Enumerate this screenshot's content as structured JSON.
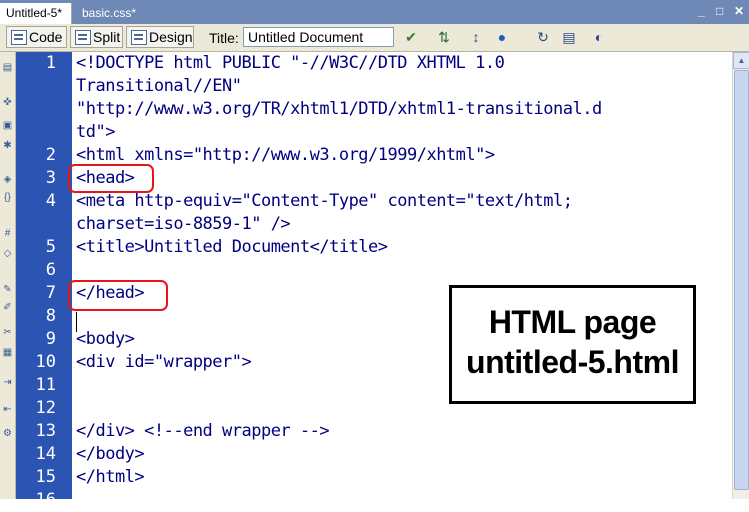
{
  "tabs": [
    {
      "label": "Untitled-5*",
      "active": true
    },
    {
      "label": "basic.css*",
      "active": false
    }
  ],
  "window_controls": {
    "minimize": "_",
    "restore": "□"
  },
  "toolbar": {
    "code_label": "Code",
    "split_label": "Split",
    "design_label": "Design",
    "title_label": "Title:",
    "title_value": "Untitled Document",
    "icons": [
      "validate-markup-icon",
      "file-management-icon",
      "preview-browser-icon",
      "refresh-icon",
      "view-options-icon",
      "visual-aids-icon"
    ]
  },
  "editor": {
    "line_numbers": [
      "1",
      "2",
      "3",
      "4",
      "5",
      "6",
      "7",
      "8",
      "9",
      "10",
      "11",
      "12",
      "13",
      "14",
      "15"
    ],
    "lines": [
      "<!DOCTYPE html PUBLIC \"-//W3C//DTD XHTML 1.0",
      "Transitional//EN\"",
      "\"http://www.w3.org/TR/xhtml1/DTD/xhtml1-transitional.d",
      "td\">",
      "<html xmlns=\"http://www.w3.org/1999/xhtml\">",
      "<head>",
      "<meta http-equiv=\"Content-Type\" content=\"text/html;",
      "charset=iso-8859-1\" />",
      "<title>Untitled Document</title>",
      "",
      "</head>",
      "",
      "<body>",
      "<div id=\"wrapper\">",
      "",
      "",
      "</div> <!--end wrapper -->",
      "</body>",
      "</html>"
    ]
  },
  "annotation": {
    "line1": "HTML page",
    "line2": "untitled-5.html"
  },
  "colors": {
    "gutter": "#2c55b3",
    "tag_text": "#000080",
    "comment_text": "#808080",
    "highlight": "#e8141b",
    "tabbar": "#6f89b6"
  }
}
